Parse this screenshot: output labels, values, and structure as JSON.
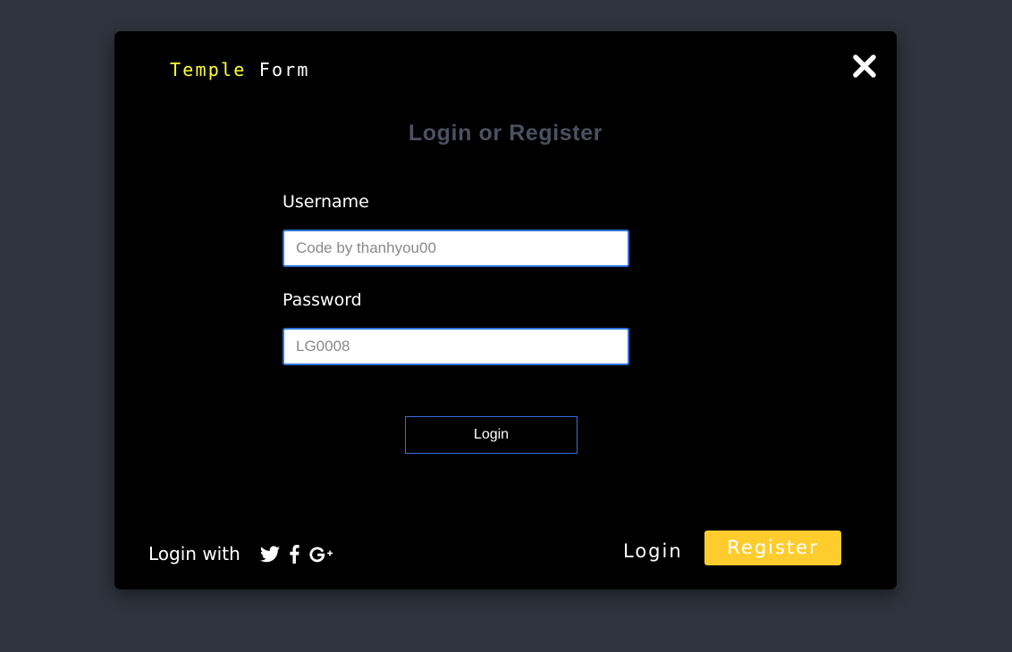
{
  "brand": {
    "word1": "Temple",
    "word2": "Form"
  },
  "header": {
    "heading": "Login or Register"
  },
  "form": {
    "username_label": "Username",
    "username_placeholder": "Code by thanhyou00",
    "password_label": "Password",
    "password_placeholder": "LG0008",
    "submit_label": "Login"
  },
  "footer": {
    "social_text": "Login with",
    "social_icons": [
      "twitter-icon",
      "facebook-icon",
      "google-plus-icon"
    ],
    "login_tab": "Login",
    "register_tab": "Register"
  },
  "colors": {
    "background": "#2e333d",
    "modal": "#000000",
    "brand_accent": "#ffff33",
    "heading": "#4b5160",
    "input_border": "#2d73d8",
    "register_button": "#ffcc2e"
  },
  "icons": {
    "close": "close-icon"
  }
}
